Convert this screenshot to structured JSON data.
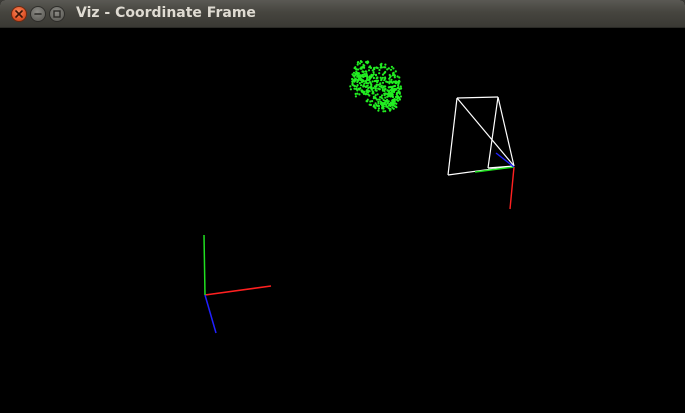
{
  "window": {
    "title": "Viz - Coordinate Frame"
  },
  "controls": {
    "close_icon": "close-icon",
    "minimize_icon": "minimize-icon",
    "maximize_icon": "maximize-icon"
  },
  "scene": {
    "background": "#000000",
    "axis_colors": {
      "x": "#ff2020",
      "y": "#20e020",
      "z": "#2020ff"
    },
    "cloud_color": "#22ee22",
    "camera_frustum_color": "#ffffff"
  }
}
